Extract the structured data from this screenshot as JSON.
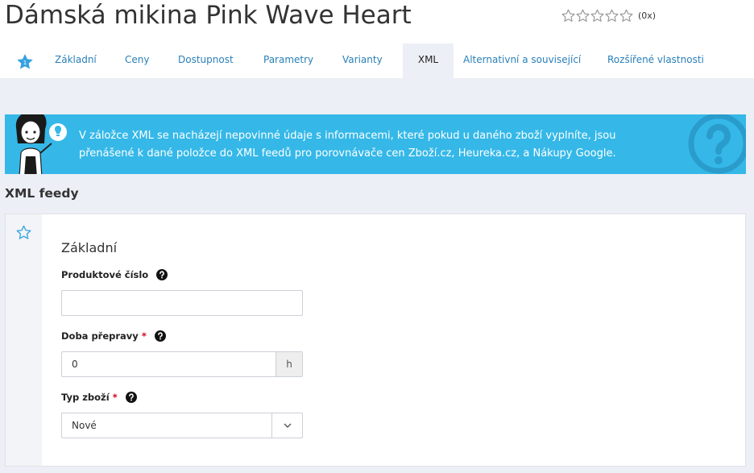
{
  "product": {
    "title": "Dámská mikina Pink Wave Heart",
    "rating_count": "(0x)"
  },
  "tabs": [
    {
      "label": "Základní"
    },
    {
      "label": "Ceny"
    },
    {
      "label": "Dostupnost"
    },
    {
      "label": "Parametry"
    },
    {
      "label": "Varianty"
    },
    {
      "label": "XML"
    },
    {
      "label": "Alternativní a související"
    },
    {
      "label": "Rozšířené vlastnosti"
    }
  ],
  "active_tab": "XML",
  "info": {
    "line1": "V záložce XML se nacházejí nepovinné údaje s informacemi, které pokud u daného zboží vyplníte, jsou",
    "line2": "přenášené k dané položce do XML feedů pro porovnávače cen Zboží.cz, Heureka.cz, a Nákupy Google."
  },
  "section": {
    "title": "XML feedy"
  },
  "card": {
    "heading": "Základní",
    "fields": {
      "product_number": {
        "label": "Produktové číslo",
        "value": ""
      },
      "delivery_time": {
        "label": "Doba přepravy",
        "required_mark": "*",
        "value": "0",
        "unit": "h"
      },
      "goods_type": {
        "label": "Typ zboží",
        "required_mark": "*",
        "value": "Nové"
      }
    }
  },
  "colors": {
    "accent": "#2a7fb8",
    "info_bg": "#35b8e8",
    "required": "#d0021b"
  }
}
